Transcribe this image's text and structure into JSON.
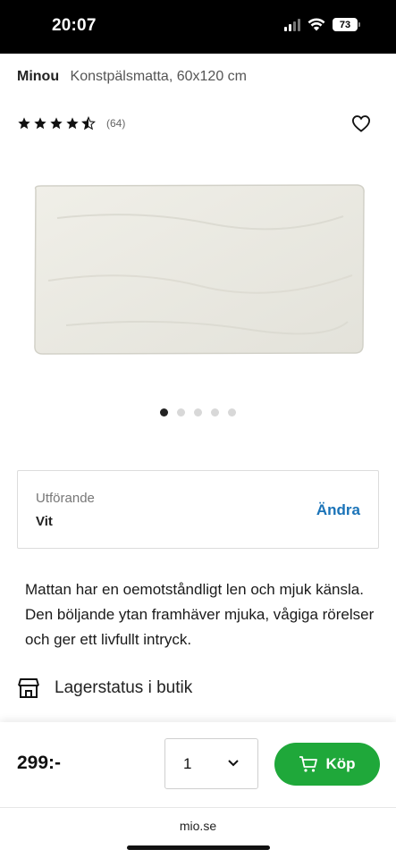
{
  "status_bar": {
    "time": "20:07",
    "battery": "73",
    "icons": [
      "signal-icon",
      "wifi-icon",
      "battery-icon"
    ]
  },
  "product": {
    "brand": "Minou",
    "name": "Konstpälsmatta, 60x120 cm",
    "rating": 4.5,
    "rating_count": "(64)",
    "image_count": 5,
    "active_image": 1,
    "image_color": "#ecebe4"
  },
  "variant": {
    "label": "Utförande",
    "value": "Vit",
    "change_label": "Ändra"
  },
  "description": "Mattan har en oemotståndligt len och mjuk känsla. Den böljande ytan framhäver mjuka, vågiga rörelser och ger ett livfullt intryck.",
  "store": {
    "label": "Lagerstatus i butik",
    "icon": "store-icon"
  },
  "purchase": {
    "price": "299:-",
    "quantity": "1",
    "buy_label": "Köp",
    "buy_color": "#1fa83a"
  },
  "browser": {
    "url": "mio.se"
  },
  "colors": {
    "link": "#1a73b8",
    "accent_green": "#1fa83a"
  }
}
